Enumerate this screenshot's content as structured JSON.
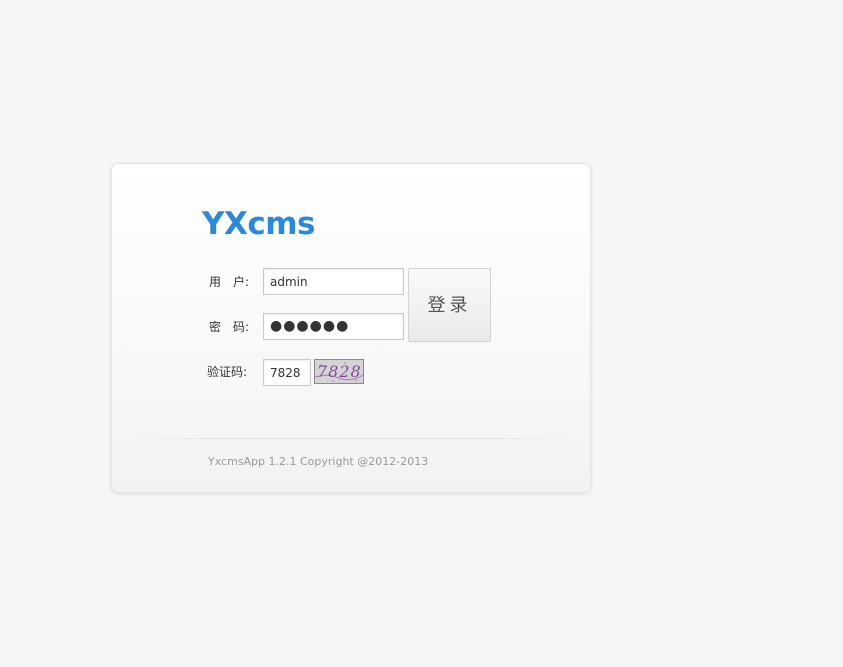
{
  "app": {
    "logo_text": "YXcms",
    "brand_color": "#2c88d9"
  },
  "form": {
    "username_label": "用　户:",
    "username_value": "admin",
    "password_label": "密　码:",
    "password_mask": "●●●●●●",
    "captcha_label": "验证码:",
    "captcha_value": "7828",
    "captcha_image_text": "7828",
    "login_button_label": "登录"
  },
  "footer": {
    "copyright": "YxcmsApp 1.2.1 Copyright @2012-2013"
  }
}
